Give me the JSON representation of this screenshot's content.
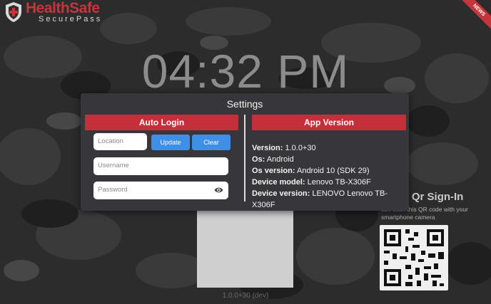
{
  "brand": {
    "name": "HealthSafe",
    "sub": "SecurePass"
  },
  "ribbon": "NEWS",
  "clock": "04:32 PM",
  "qr": {
    "title": "ss Qr Sign-In",
    "subtitle": "ase scan this QR code with your smartphone camera"
  },
  "footer_version": "1.0.0+30 (dev)",
  "settings": {
    "title": "Settings",
    "auto_login": {
      "header": "Auto Login",
      "location_placeholder": "Location",
      "update_label": "Update",
      "clear_label": "Clear",
      "username_placeholder": "Username",
      "password_placeholder": "Password"
    },
    "app_version": {
      "header": "App Version",
      "rows": [
        {
          "key": "Version:",
          "value": "1.0.0+30"
        },
        {
          "key": "Os:",
          "value": "Android"
        },
        {
          "key": "Os version:",
          "value": "Android 10 (SDK 29)"
        },
        {
          "key": "Device model:",
          "value": "Lenovo TB-X306F"
        },
        {
          "key": "Device version:",
          "value": "LENOVO Lenovo TB-X306F"
        }
      ]
    }
  },
  "colors": {
    "accent": "#c3303a",
    "button": "#3f8fe7",
    "modal": "#37373b"
  },
  "icons": {
    "eye": "eye-icon",
    "logo": "shield-logo-icon"
  }
}
